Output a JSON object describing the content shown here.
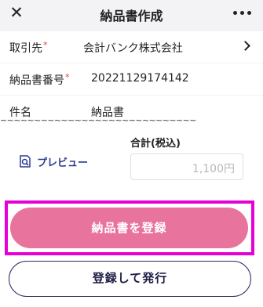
{
  "header": {
    "title": "納品書作成",
    "close_icon": "close-icon",
    "more_icon": "more-horizontal-icon"
  },
  "form": {
    "client": {
      "label": "取引先",
      "required_mark": "*",
      "value": "会計バンク株式会社"
    },
    "invoice_number": {
      "label": "納品書番号",
      "required_mark": "*",
      "value": "20221129174142"
    },
    "subject": {
      "label": "件名",
      "value": "納品書"
    }
  },
  "torn_edge": "~~~~~~~~~~~~~~~~~~~~~~~~~~~~~",
  "footer": {
    "preview_label": "プレビュー",
    "total_label": "合計(税込)",
    "total_value": "1,100円",
    "register_button": "納品書を登録",
    "issue_button": "登録して発行"
  },
  "colors": {
    "register": "#e8739c",
    "highlight": "#e600d6",
    "issue_border": "#2b2b63",
    "required": "#e23b3b"
  }
}
